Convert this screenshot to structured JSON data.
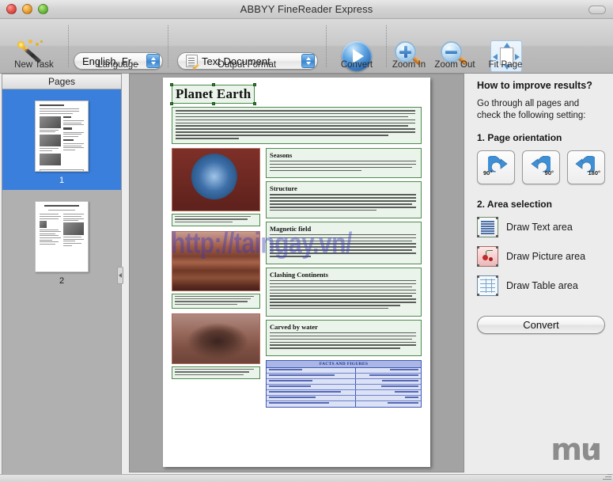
{
  "window": {
    "title": "ABBYY FineReader Express",
    "controls": {
      "close": "close-button",
      "minimize": "minimize-button",
      "maximize": "maximize-button"
    }
  },
  "toolbar": {
    "new_task": {
      "label": "New Task",
      "icon": "magic-wand-icon"
    },
    "language": {
      "group_label": "Language",
      "value": "English, Fr..."
    },
    "output_format": {
      "group_label": "Output Format",
      "value": "Text Document",
      "icon": "document-icon"
    },
    "convert": {
      "label": "Convert",
      "icon": "play-circle-icon"
    },
    "zoom_in": {
      "label": "Zoom In",
      "icon": "magnifier-plus-icon"
    },
    "zoom_out": {
      "label": "Zoom Out",
      "icon": "magnifier-minus-icon"
    },
    "fit_page": {
      "label": "Fit Page",
      "icon": "fit-page-icon"
    }
  },
  "sidebar": {
    "header": "Pages",
    "pages": [
      {
        "number": "1",
        "selected": true
      },
      {
        "number": "2",
        "selected": false
      }
    ]
  },
  "document": {
    "title": "Planet Earth",
    "watermark": "http://taingay.vn/",
    "headings": [
      "Seasons",
      "Structure",
      "Magnetic field",
      "Clashing Continents",
      "Carved by water"
    ],
    "table": {
      "title": "FACTS AND FIGURES",
      "rows": [
        {
          "label": "Diameter",
          "value": "12 756 km"
        },
        {
          "label": "Mean distance from Sun",
          "value": "149 600 000 km"
        },
        {
          "label": "Orbital speed",
          "value": "29.79 km/sec"
        },
        {
          "label": "Orbital period",
          "value": "365.26 days"
        },
        {
          "label": "Day (from sunrise to sunrise)",
          "value": "24 hours"
        },
        {
          "label": "Average density",
          "value": "5.52"
        },
        {
          "label": "Temperature at surface",
          "value": "-70° - +55°C"
        }
      ]
    },
    "images": [
      "earth-photo",
      "canyon-photo",
      "river-delta-photo"
    ]
  },
  "right_panel": {
    "heading": "How to improve results?",
    "intro": "Go through all pages and check the following setting:",
    "step1_label": "1. Page orientation",
    "rotate_buttons": [
      {
        "name": "rotate-left-90",
        "label": "90°"
      },
      {
        "name": "rotate-right-90",
        "label": "90°"
      },
      {
        "name": "rotate-180",
        "label": "180°"
      }
    ],
    "step2_label": "2. Area selection",
    "area_tools": [
      {
        "name": "draw-text-area",
        "label": "Draw Text area",
        "icon": "text-area-icon"
      },
      {
        "name": "draw-picture-area",
        "label": "Draw Picture area",
        "icon": "picture-area-icon"
      },
      {
        "name": "draw-table-area",
        "label": "Draw Table area",
        "icon": "table-area-icon"
      }
    ],
    "convert_label": "Convert",
    "logo": "mu"
  },
  "colors": {
    "selection_blue": "#3a7fdb",
    "text_block_green": "#4f8a4f",
    "picture_block_red": "#b06a5c",
    "table_block_blue": "#3f57b5",
    "watermark_blue": "#3a3abe"
  }
}
